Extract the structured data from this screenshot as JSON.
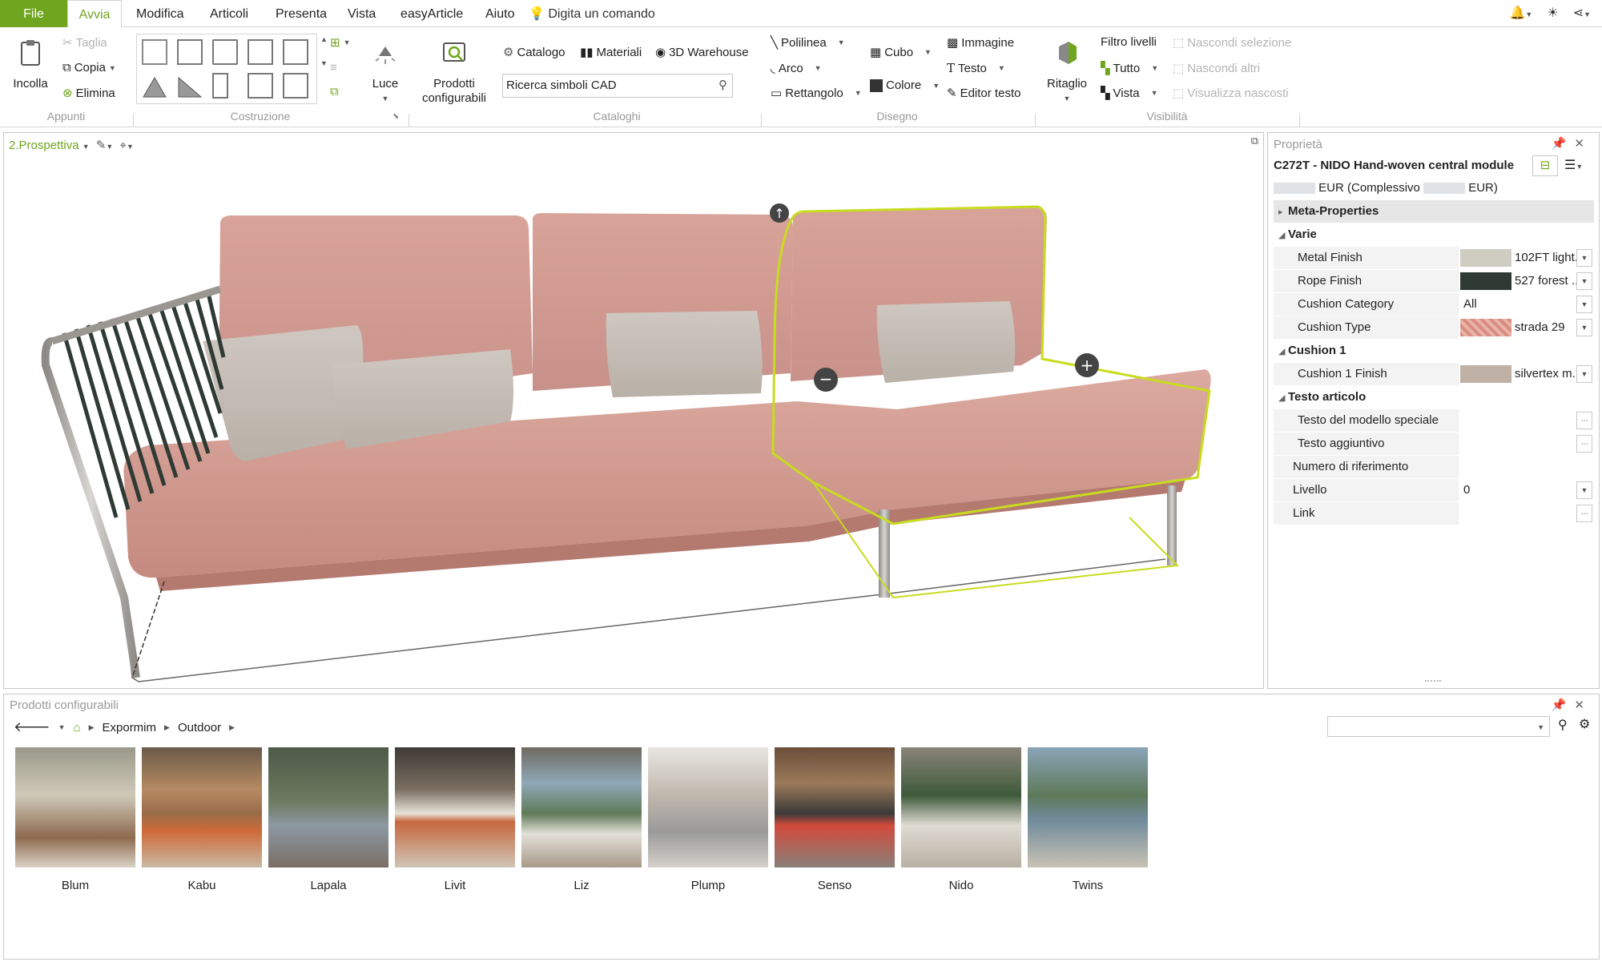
{
  "menu": {
    "tabs": [
      "File",
      "Avvia",
      "Modifica",
      "Articoli",
      "Presenta",
      "Vista",
      "easyArticle",
      "Aiuto"
    ],
    "tell_me": "Digita un comando"
  },
  "ribbon": {
    "clipboard": {
      "paste": "Incolla",
      "cut": "Taglia",
      "copy": "Copia",
      "delete": "Elimina",
      "group": "Appunti"
    },
    "construction": {
      "group": "Costruzione"
    },
    "light": "Luce",
    "configurable": "Prodotti configurabili",
    "catalogs": {
      "catalog": "Catalogo",
      "materials": "Materiali",
      "warehouse": "3D Warehouse",
      "search_value": "Ricerca simboli CAD",
      "group": "Cataloghi"
    },
    "drawing": {
      "polyline": "Polilinea",
      "arc": "Arco",
      "rectangle": "Rettangolo",
      "cube": "Cubo",
      "color": "Colore",
      "image": "Immagine",
      "text": "Testo",
      "text_editor": "Editor testo",
      "group": "Disegno"
    },
    "clip": "Ritaglio",
    "visibility": {
      "level_filter": "Filtro livelli",
      "all": "Tutto",
      "view": "Vista",
      "hide_selection": "Nascondi selezione",
      "hide_others": "Nascondi altri",
      "show_hidden": "Visualizza nascosti",
      "group": "Visibilità"
    }
  },
  "viewport": {
    "title": "2.Prospettiva"
  },
  "properties": {
    "header": "Proprietà",
    "title": "C272T - NIDO Hand-woven central module",
    "price_mid": "EUR (Complessivo",
    "price_end": "EUR)",
    "sections": {
      "meta": "Meta-Properties",
      "varie": "Varie",
      "cushion1": "Cushion 1",
      "testo": "Testo articolo"
    },
    "rows": {
      "metal_finish": {
        "label": "Metal Finish",
        "value": "102FT light..."
      },
      "rope_finish": {
        "label": "Rope Finish",
        "value": "527 forest ..."
      },
      "cushion_category": {
        "label": "Cushion Category",
        "value": "All"
      },
      "cushion_type": {
        "label": "Cushion Type",
        "value": "strada 29"
      },
      "cushion1_finish": {
        "label": "Cushion 1 Finish",
        "value": "silvertex m..."
      },
      "special_text": {
        "label": "Testo del modello speciale"
      },
      "extra_text": {
        "label": "Testo aggiuntivo"
      },
      "ref_number": {
        "label": "Numero di riferimento"
      },
      "level": {
        "label": "Livello",
        "value": "0"
      },
      "link": {
        "label": "Link"
      }
    }
  },
  "bottom": {
    "header": "Prodotti configurabili",
    "breadcrumb": [
      "Expormim",
      "Outdoor"
    ],
    "products": [
      "Blum",
      "Kabu",
      "Lapala",
      "Livit",
      "Liz",
      "Plump",
      "Senso",
      "Nido",
      "Twins"
    ]
  },
  "colors": {
    "accent": "#6fa51f",
    "selection": "#c8dc1e",
    "cushion": "#d9a197",
    "rope": "#2f3a34"
  }
}
